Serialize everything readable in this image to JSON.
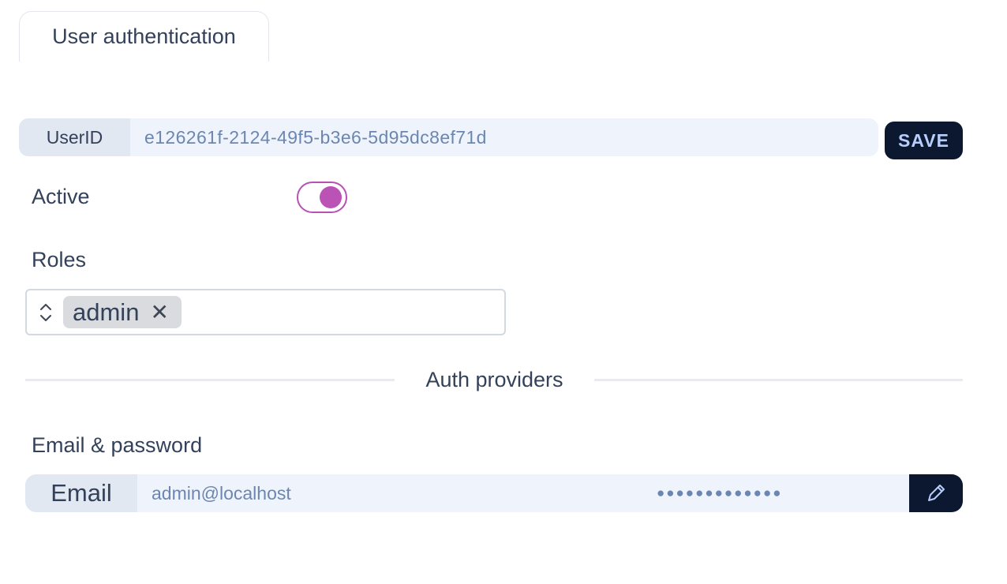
{
  "tab": {
    "label": "User authentication"
  },
  "user_id": {
    "label": "UserID",
    "value": "e126261f-2124-49f5-b3e6-5d95dc8ef71d"
  },
  "save_button": {
    "label": "SAVE"
  },
  "active": {
    "label": "Active",
    "checked": true
  },
  "roles": {
    "label": "Roles",
    "selected": [
      {
        "label": "admin",
        "remove_icon": "close-icon"
      }
    ]
  },
  "auth_providers": {
    "title": "Auth providers"
  },
  "email_password": {
    "label": "Email & password",
    "field_label": "Email",
    "email": "admin@localhost",
    "password_mask": "●●●●●●●●●●●●●",
    "edit_icon": "pencil-icon"
  },
  "colors": {
    "accent": "#bb52b6",
    "button_bg": "#0c1730",
    "button_text": "#b7cdfa",
    "field_bg": "#eff4fc",
    "field_text": "#6b86b0"
  }
}
